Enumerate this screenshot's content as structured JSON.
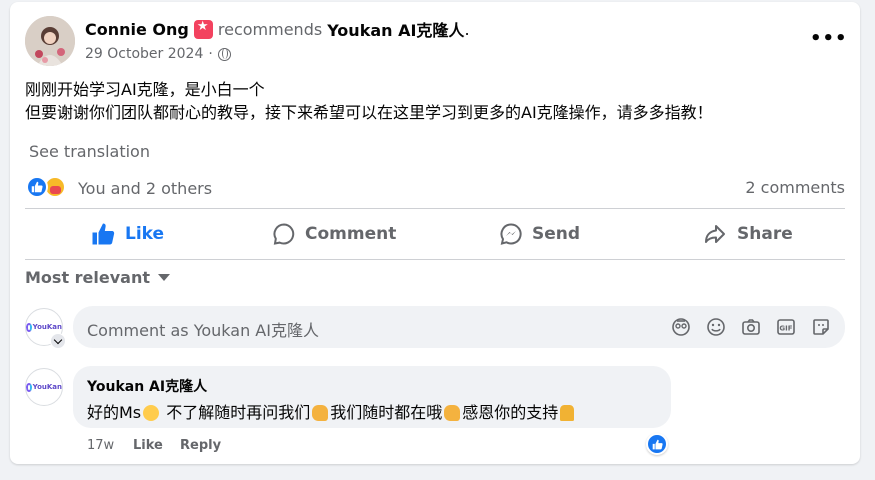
{
  "post": {
    "author": "Connie Ong",
    "recommends_label": "recommends",
    "page_name": "Youkan AI克隆人",
    "page_suffix": ".",
    "date": "29 October 2024",
    "date_separator": "·",
    "more_label": "•••",
    "text_line_1": "刚刚开始学习AI克隆，是小白一个",
    "text_line_2": "但要谢谢你们团队都耐心的教导，接下来希望可以在这里学习到更多的AI克隆操作，请多多指教！",
    "see_translation": "See translation"
  },
  "reactions": {
    "summary": "You and 2 others",
    "comment_count": "2 comments"
  },
  "actions": {
    "like": "Like",
    "comment": "Comment",
    "send": "Send",
    "share": "Share"
  },
  "comments_section": {
    "sort_label": "Most relevant",
    "input_placeholder": "Comment as Youkan AI克隆人",
    "avatar_logo_text": "YouKan"
  },
  "comment": {
    "author": "Youkan AI克隆人",
    "text_part_1": "好的Ms",
    "text_part_2": " 不了解随时再问我们",
    "text_part_3": "我们随时都在哦",
    "text_part_4": "感恩你的支持",
    "time": "17w",
    "like_label": "Like",
    "reply_label": "Reply"
  },
  "colors": {
    "accent": "#1877f2",
    "muted_text": "#65676b",
    "bubble_background": "#f0f2f5"
  }
}
